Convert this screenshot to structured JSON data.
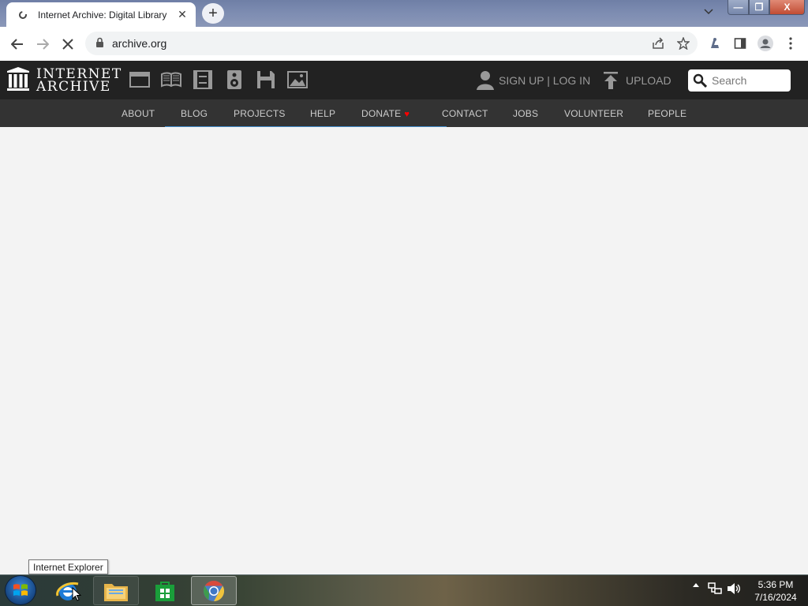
{
  "browser": {
    "tab_title": "Internet Archive: Digital Library",
    "new_tab_label": "+",
    "close_tab_label": "✕",
    "url": "archive.org"
  },
  "window_controls": {
    "minimize": "—",
    "maximize": "❐",
    "close": "X"
  },
  "ia_header": {
    "logo_line1": "INTERNET",
    "logo_line2": "ARCHIVE",
    "media_icons": [
      "web-icon",
      "texts-icon",
      "video-icon",
      "audio-icon",
      "software-icon",
      "images-icon"
    ],
    "sign_up_login": "SIGN UP | LOG IN",
    "upload": "UPLOAD",
    "search_placeholder": "Search"
  },
  "nav": {
    "items": [
      "ABOUT",
      "BLOG",
      "PROJECTS",
      "HELP",
      "DONATE",
      "CONTACT",
      "JOBS",
      "VOLUNTEER",
      "PEOPLE"
    ],
    "donate_heart": "♥"
  },
  "tooltip": "Internet Explorer",
  "taskbar": {
    "items": [
      "internet-explorer-icon",
      "file-explorer-icon",
      "store-icon",
      "chrome-icon"
    ],
    "time": "5:36 PM",
    "date": "7/16/2024"
  },
  "colors": {
    "ia_header_bg": "#222222",
    "ia_nav_bg": "#333333",
    "loading_bar": "#428bca",
    "donate_heart": "#ff0000"
  }
}
